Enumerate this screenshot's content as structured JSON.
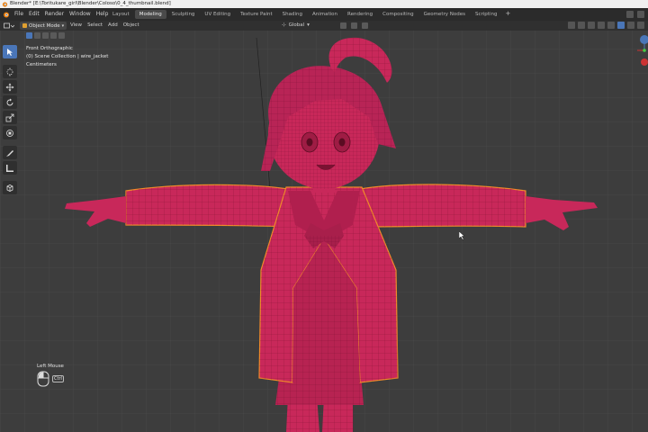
{
  "window": {
    "title": "Blender* [E:\\Toritukare_girl\\Blender\\Coloso\\0_4_thumbnail.blend]"
  },
  "menu": [
    "File",
    "Edit",
    "Render",
    "Window",
    "Help"
  ],
  "workspace_tabs": [
    {
      "label": "Layout",
      "active": false
    },
    {
      "label": "Modeling",
      "active": true
    },
    {
      "label": "Sculpting",
      "active": false
    },
    {
      "label": "UV Editing",
      "active": false
    },
    {
      "label": "Texture Paint",
      "active": false
    },
    {
      "label": "Shading",
      "active": false
    },
    {
      "label": "Animation",
      "active": false
    },
    {
      "label": "Rendering",
      "active": false
    },
    {
      "label": "Compositing",
      "active": false
    },
    {
      "label": "Geometry Nodes",
      "active": false
    },
    {
      "label": "Scripting",
      "active": false
    }
  ],
  "workspace_add": "+",
  "viewport_header": {
    "mode": "Object Mode",
    "menus": [
      "View",
      "Select",
      "Add",
      "Object"
    ],
    "orientation": "Global"
  },
  "overlay_text": {
    "view": "Front Orthographic",
    "collection": "(0) Scene Collection | wire_jacket",
    "units": "Centimeters"
  },
  "toolbar": [
    {
      "icon": "select-cursor-icon",
      "active": true
    },
    {
      "icon": "3d-cursor-icon",
      "active": false
    },
    {
      "icon": "move-icon",
      "active": false
    },
    {
      "icon": "rotate-icon",
      "active": false
    },
    {
      "icon": "scale-icon",
      "active": false
    },
    {
      "icon": "transform-icon",
      "active": false
    },
    {
      "icon": "annotate-icon",
      "active": false
    },
    {
      "icon": "measure-icon",
      "active": false
    },
    {
      "icon": "add-cube-icon",
      "active": false
    }
  ],
  "status": {
    "left_mouse": "Left Mouse",
    "ctrl": "Ctrl"
  },
  "colors": {
    "model": "#c8285a",
    "model_dark": "#a81f4b",
    "wire": "#7a1232",
    "selected_outline": "#f08a2a",
    "grid_bg": "#3d3d3d",
    "grid_line": "#4a4a4a",
    "active_blue": "#4a76b8"
  }
}
